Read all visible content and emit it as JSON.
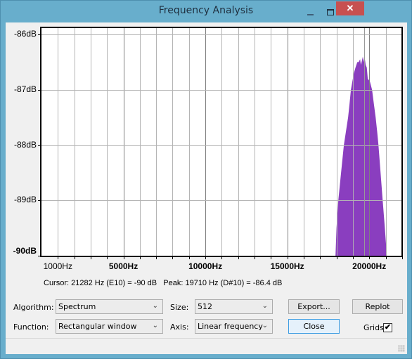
{
  "window": {
    "title": "Frequency Analysis",
    "close_glyph": "✕"
  },
  "colors": {
    "spectrum_fill": "#8a3ebf",
    "grid_minor": "#b4b4b4",
    "grid_major": "#808080",
    "peak_line": "#999999",
    "titlebar": "#68aecc",
    "close_button": "#c75050"
  },
  "chart_data": {
    "type": "area",
    "title": "Frequency Analysis",
    "xlabel": "",
    "ylabel": "",
    "xlim": [
      0,
      22050
    ],
    "ylim": [
      -90,
      -86
    ],
    "grid": true,
    "x_ticks": [
      {
        "value": 1000,
        "label": "1000Hz",
        "major": false
      },
      {
        "value": 5000,
        "label": "5000Hz",
        "major": true
      },
      {
        "value": 10000,
        "label": "10000Hz",
        "major": true
      },
      {
        "value": 15000,
        "label": "15000Hz",
        "major": true
      },
      {
        "value": 20000,
        "label": "20000Hz",
        "major": true
      }
    ],
    "x_minor_step": 1000,
    "y_ticks": [
      {
        "value": -86,
        "label": "-86dB"
      },
      {
        "value": -87,
        "label": "-87dB"
      },
      {
        "value": -88,
        "label": "-88dB"
      },
      {
        "value": -89,
        "label": "-89dB"
      },
      {
        "value": -90,
        "label": "-90dB"
      }
    ],
    "series": [
      {
        "name": "Spectrum",
        "x": [
          17940,
          18000,
          18110,
          18280,
          18450,
          18580,
          18710,
          18800,
          18880,
          18970,
          19060,
          19160,
          19270,
          19350,
          19440,
          19490,
          19530,
          19570,
          19610,
          19660,
          19710,
          19780,
          19850,
          19910,
          20040,
          20170,
          20280,
          20390,
          20480,
          20560,
          20690,
          20820,
          20950,
          21070
        ],
        "y": [
          -90,
          -89.5,
          -89.0,
          -88.5,
          -88.0,
          -87.75,
          -87.5,
          -87.25,
          -87.0,
          -86.85,
          -86.7,
          -86.6,
          -86.5,
          -86.5,
          -86.45,
          -86.55,
          -86.5,
          -86.45,
          -86.4,
          -86.5,
          -86.4,
          -86.55,
          -86.6,
          -86.8,
          -86.85,
          -87.0,
          -87.25,
          -87.5,
          -87.75,
          -88.0,
          -88.5,
          -89.0,
          -89.5,
          -90
        ]
      }
    ],
    "peak_marker": {
      "x": 19710
    },
    "legend": "none"
  },
  "status": {
    "cursor_text": "Cursor: 21282 Hz (E10) = -90 dB",
    "peak_text": "Peak: 19710 Hz (D#10) = -86.4 dB"
  },
  "controls": {
    "algorithm_label": "Algorithm:",
    "algorithm_value": "Spectrum",
    "function_label": "Function:",
    "function_value": "Rectangular window",
    "size_label": "Size:",
    "size_value": "512",
    "axis_label": "Axis:",
    "axis_value": "Linear frequency",
    "export_label": "Export...",
    "replot_label": "Replot",
    "close_label": "Close",
    "grids_label": "Grids",
    "grids_checked": true,
    "check_glyph": "✔",
    "chevron_glyph": "⌄"
  }
}
